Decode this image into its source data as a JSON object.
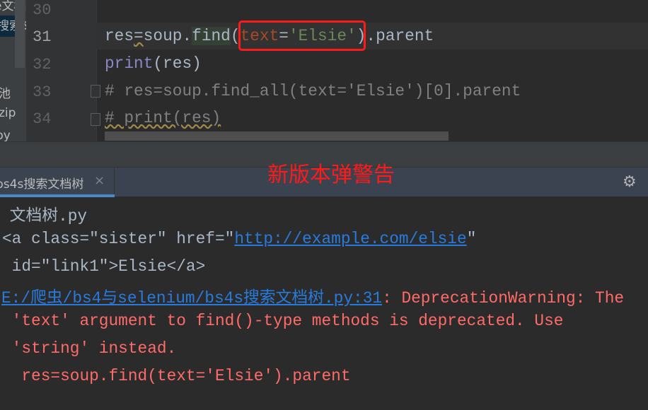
{
  "project_panel": {
    "items": [
      "e文档",
      "搜索文",
      "池",
      "zip",
      "py"
    ]
  },
  "editor": {
    "line_numbers": [
      "30",
      "31",
      "32",
      "33",
      "34"
    ],
    "current_line": "31",
    "lines": {
      "l31": {
        "a": "res",
        "b": "=",
        "c": "soup.",
        "d": "find",
        "e": "(",
        "f": "text",
        "g": "=",
        "h": "'Elsie'",
        "i": ").parent"
      },
      "l32": {
        "a": "print",
        "b": "(res)"
      },
      "l33": "# res=soup.find_all(text='Elsie')[0].parent",
      "l34": "# print(res)"
    }
  },
  "annotation": "新版本弹警告",
  "run_panel": {
    "tab_label": "bs4s搜索文档树",
    "close_icon": "×",
    "settings_icon": "gear-icon"
  },
  "console": {
    "line1": " 文档树.py",
    "line2_a": "<a class=\"sister\" href=\"",
    "line2_link": "http://example.com/elsie",
    "line2_b": "\"",
    "line3": " id=\"link1\">Elsie</a>",
    "line4_link": "E:/爬虫/bs4与selenium/bs4s搜索文档树.py:31",
    "line4_b": ": DeprecationWarning: The",
    "line5": " 'text' argument to find()-type methods is deprecated. Use",
    "line6": " 'string' instead.",
    "line7": "  res=soup.find(text='Elsie').parent"
  },
  "colors": {
    "warning": "#ff6b68",
    "link": "#287bde",
    "annotation": "#ff1a1a"
  }
}
